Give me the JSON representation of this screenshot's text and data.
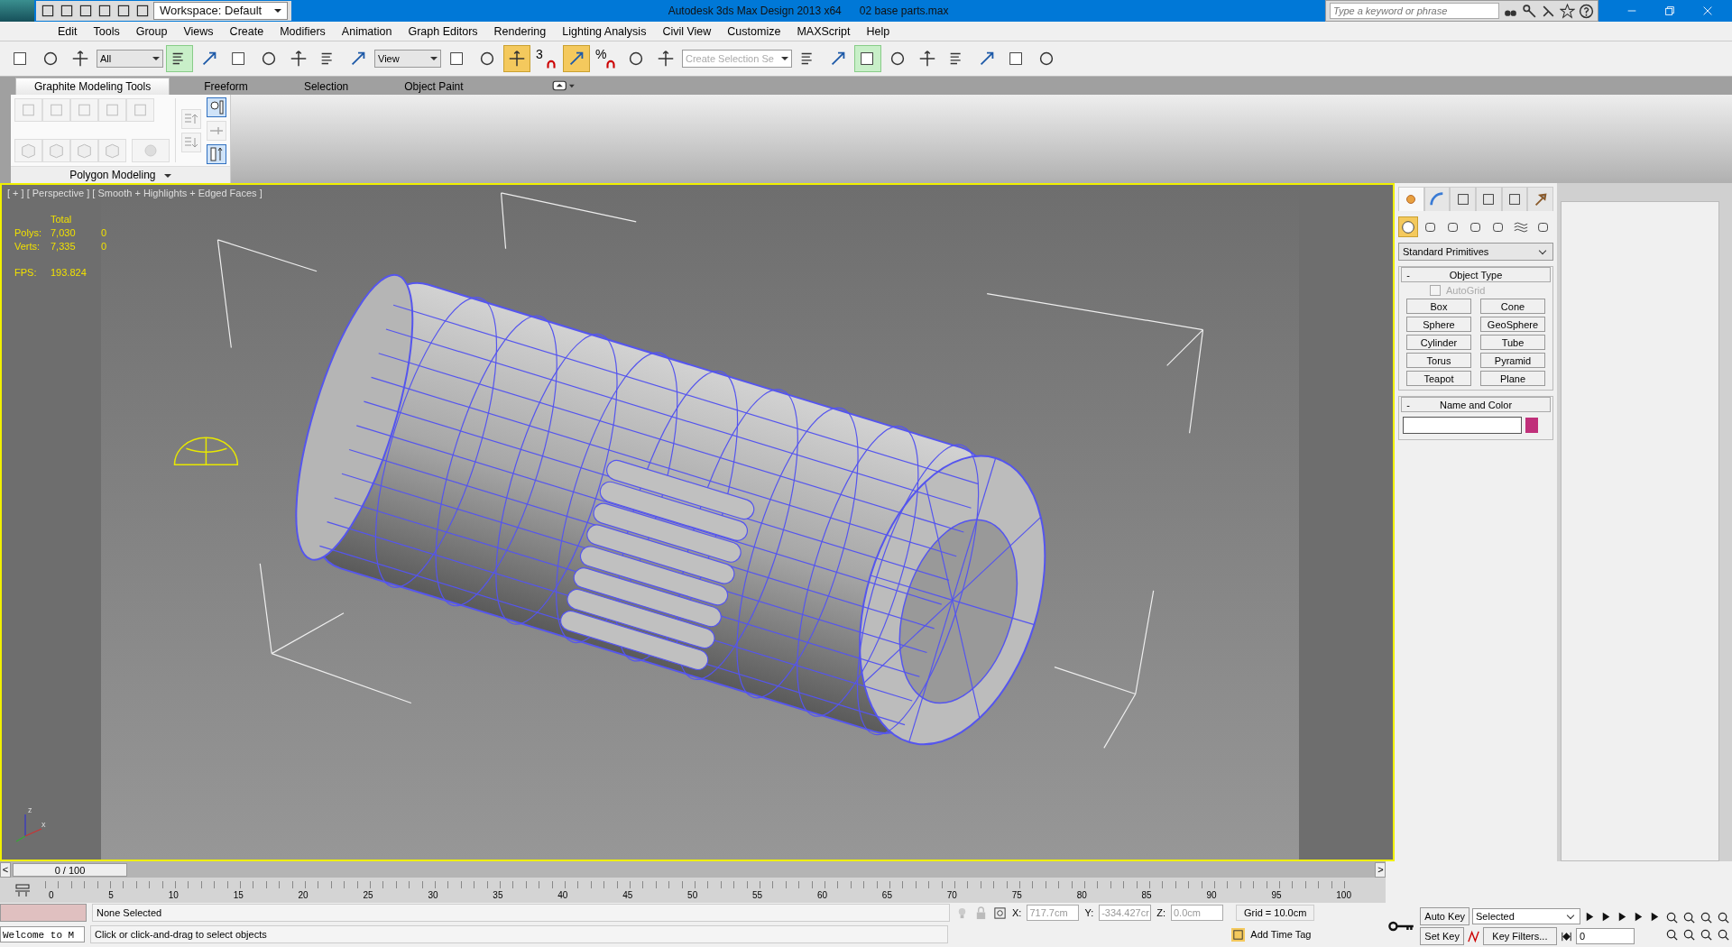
{
  "title_bar": {
    "workspace": "Workspace: Default",
    "title": "Autodesk 3ds Max Design 2013 x64      02 base parts.max",
    "search": {
      "placeholder": "Type a keyword or phrase"
    }
  },
  "menu": [
    "Edit",
    "Tools",
    "Group",
    "Views",
    "Create",
    "Modifiers",
    "Animation",
    "Graph Editors",
    "Rendering",
    "Lighting Analysis",
    "Civil View",
    "Customize",
    "MAXScript",
    "Help"
  ],
  "toolbar": {
    "selection_filter": "All",
    "reference_coord": "View",
    "snap_label": "3",
    "percent_label": "%",
    "named_selection": {
      "placeholder": "Create Selection Se"
    },
    "tools": [
      {
        "active": false
      },
      {
        "active": false
      },
      {
        "active": false
      },
      {
        "active": true
      },
      {
        "active": false
      },
      {
        "active": false
      },
      {
        "active": false
      },
      {
        "active": false
      },
      {
        "active": false
      },
      {
        "active": false
      },
      {
        "active": false
      },
      {
        "active": false
      },
      {
        "active": true
      },
      {
        "active": false
      },
      {
        "active": true
      },
      {
        "active": false
      },
      {
        "active": false
      },
      {
        "active": false
      },
      {
        "active": false
      },
      {
        "active": false
      },
      {
        "active": true
      },
      {
        "active": false
      },
      {
        "active": false
      },
      {
        "active": false
      },
      {
        "active": false
      },
      {
        "active": false
      },
      {
        "active": false
      }
    ]
  },
  "ribbon": {
    "tabs": [
      {
        "label": "Graphite Modeling Tools",
        "selected": true
      },
      {
        "label": "Freeform",
        "selected": false
      },
      {
        "label": "Selection",
        "selected": false
      },
      {
        "label": "Object Paint",
        "selected": false
      }
    ],
    "panel_title": "Polygon Modeling"
  },
  "viewport": {
    "labels": [
      "[ + ]",
      "[ Perspective ]",
      "[ Smooth + Highlights + Edged Faces ]"
    ],
    "stats_header": "Total",
    "stats": [
      {
        "label": "Polys:",
        "total": "7,030",
        "selected": "0"
      },
      {
        "label": "Verts:",
        "total": "7,335",
        "selected": "0"
      }
    ],
    "fps": {
      "label": "FPS:",
      "value": "193.824"
    },
    "axis_labels": [
      "z",
      "x"
    ]
  },
  "command_panel": {
    "tabs": [
      {
        "selected": true
      },
      {
        "selected": false
      },
      {
        "selected": false
      },
      {
        "selected": false
      },
      {
        "selected": false
      },
      {
        "selected": false
      }
    ],
    "categories": [
      {
        "selected": true
      },
      {
        "selected": false
      },
      {
        "selected": false
      },
      {
        "selected": false
      },
      {
        "selected": false
      },
      {
        "selected": false
      },
      {
        "selected": false
      }
    ],
    "dropdown": "Standard Primitives",
    "object_type": {
      "collapse": "-",
      "title": "Object Type",
      "autogrid": {
        "label": "AutoGrid",
        "checked": false,
        "disabled": true
      },
      "buttons": [
        "Box",
        "Cone",
        "Sphere",
        "GeoSphere",
        "Cylinder",
        "Tube",
        "Torus",
        "Pyramid",
        "Teapot",
        "Plane"
      ]
    },
    "name_and_color": {
      "collapse": "-",
      "title": "Name and Color",
      "color": "#c0307a"
    }
  },
  "timeline": {
    "prev": "<",
    "position": "0 / 100",
    "next": ">",
    "level": 0,
    "ticks": [
      "0",
      "5",
      "10",
      "15",
      "20",
      "25",
      "30",
      "35",
      "40",
      "45",
      "50",
      "55",
      "60",
      "65",
      "70",
      "75",
      "80",
      "85",
      "90",
      "95",
      "100"
    ]
  },
  "status_bar": {
    "listener": "Welcome to M",
    "selection": "None Selected",
    "prompt": "Click or click-and-drag to select objects",
    "coords": [
      {
        "label": "X:",
        "value": "717.7cm"
      },
      {
        "label": "Y:",
        "value": "-334.427cr"
      },
      {
        "label": "Z:",
        "value": "0.0cm"
      }
    ],
    "grid": "Grid = 10.0cm",
    "time_tag": "Add Time Tag",
    "auto_key": "Auto Key",
    "set_key": "Set Key",
    "key_mode": "Selected",
    "key_filters": "Key Filters...",
    "frame": "0"
  }
}
